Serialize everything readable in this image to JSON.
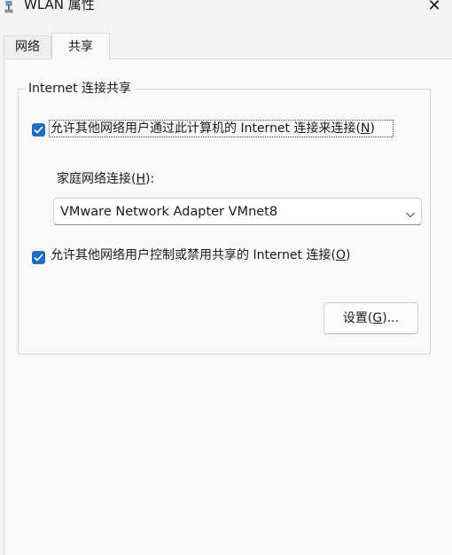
{
  "window": {
    "title": "WLAN 属性",
    "close_glyph": "✕",
    "icon": "network-adapter-icon"
  },
  "tabs": [
    {
      "label": "网络",
      "active": false
    },
    {
      "label": "共享",
      "active": true
    }
  ],
  "sharing": {
    "group_title": "Internet 连接共享",
    "allow_share": {
      "checked": true,
      "label_pre": "允许其他网络用户通过此计算机的 Internet 连接来连接(",
      "accel": "N",
      "label_post": ")"
    },
    "home_network": {
      "label_pre": "家庭网络连接(",
      "accel": "H",
      "label_post": "):",
      "selected": "VMware Network Adapter VMnet8"
    },
    "allow_control": {
      "checked": true,
      "label_pre": "允许其他网络用户控制或禁用共享的 Internet 连接(",
      "accel": "O",
      "label_post": ")"
    },
    "settings_button": {
      "label_pre": "设置(",
      "accel": "G",
      "label_post": ")..."
    }
  },
  "colors": {
    "checkbox_accent": "#1f6cc1",
    "window_bg": "#f3f3f3",
    "panel_bg": "#f9f9f9"
  }
}
